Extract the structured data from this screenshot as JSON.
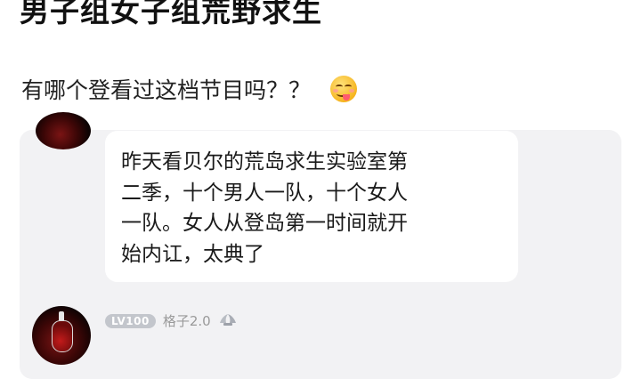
{
  "post": {
    "title": "男子组女子组荒野求生",
    "body": "有哪个登看过这档节目吗？？"
  },
  "reply": {
    "lines": [
      "昨天看贝尔的荒岛求生实验室第",
      "二季，十个男人一队，十个女人",
      "一队。女人从登岛第一时间就开",
      "始内讧，太典了"
    ]
  },
  "next_comment": {
    "level": "LV100",
    "username": "格子2.0"
  },
  "icons": {
    "post_emoji": "yummy-face-emoji",
    "badge": "honor-wings-icon"
  },
  "colors": {
    "card_bg": "#f2f2f4",
    "bubble_bg": "#ffffff",
    "badge_bg": "#c3c6cc",
    "meta_text": "#9a9a9a"
  }
}
